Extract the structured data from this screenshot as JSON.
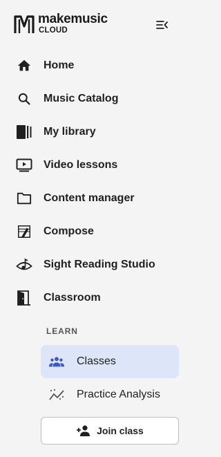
{
  "brand": {
    "line1": "makemusic",
    "line2": "CLOUD"
  },
  "nav": [
    {
      "label": "Home",
      "icon": "home-icon"
    },
    {
      "label": "Music Catalog",
      "icon": "search-icon"
    },
    {
      "label": "My library",
      "icon": "library-icon"
    },
    {
      "label": "Video lessons",
      "icon": "video-icon"
    },
    {
      "label": "Content manager",
      "icon": "folder-icon"
    },
    {
      "label": "Compose",
      "icon": "compose-icon"
    },
    {
      "label": "Sight Reading Studio",
      "icon": "eye-note-icon"
    },
    {
      "label": "Classroom",
      "icon": "door-icon"
    }
  ],
  "learn": {
    "section_label": "LEARN",
    "items": [
      {
        "label": "Classes",
        "icon": "people-icon",
        "active": true
      },
      {
        "label": "Practice Analysis",
        "icon": "analytics-icon",
        "active": false
      }
    ]
  },
  "join_button": {
    "label": "Join class",
    "icon": "person-add-icon"
  },
  "colors": {
    "active_bg": "#dde5f8",
    "active_icon": "#3b5bc4",
    "background": "#f4f4f4"
  }
}
